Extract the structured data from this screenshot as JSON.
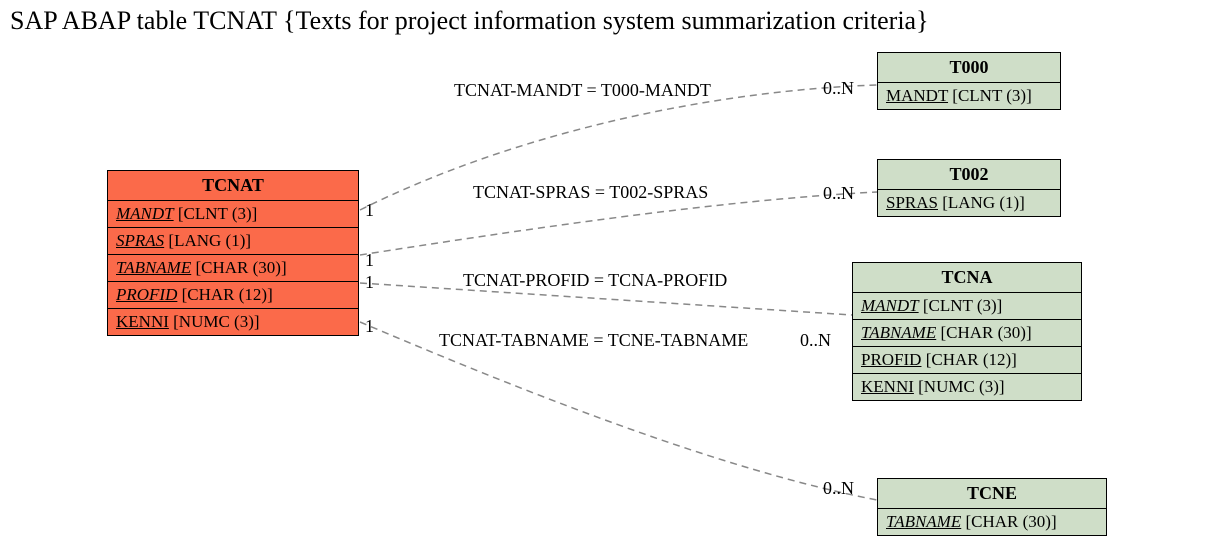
{
  "title": "SAP ABAP table TCNAT {Texts for project information system summarization criteria}",
  "main": {
    "name": "TCNAT",
    "fields": [
      {
        "name": "MANDT",
        "type": "[CLNT (3)]",
        "key": true
      },
      {
        "name": "SPRAS",
        "type": "[LANG (1)]",
        "key": true
      },
      {
        "name": "TABNAME",
        "type": "[CHAR (30)]",
        "key": true
      },
      {
        "name": "PROFID",
        "type": "[CHAR (12)]",
        "key": true
      },
      {
        "name": "KENNI",
        "type": "[NUMC (3)]",
        "key": false
      }
    ]
  },
  "targets": [
    {
      "name": "T000",
      "fields": [
        {
          "name": "MANDT",
          "type": "[CLNT (3)]",
          "key": false,
          "ul": true
        }
      ]
    },
    {
      "name": "T002",
      "fields": [
        {
          "name": "SPRAS",
          "type": "[LANG (1)]",
          "key": false,
          "ul": true
        }
      ]
    },
    {
      "name": "TCNA",
      "fields": [
        {
          "name": "MANDT",
          "type": "[CLNT (3)]",
          "key": true,
          "ul": true
        },
        {
          "name": "TABNAME",
          "type": "[CHAR (30)]",
          "key": true,
          "ul": true
        },
        {
          "name": "PROFID",
          "type": "[CHAR (12)]",
          "key": false,
          "ul": true
        },
        {
          "name": "KENNI",
          "type": "[NUMC (3)]",
          "key": false,
          "ul": true
        }
      ]
    },
    {
      "name": "TCNE",
      "fields": [
        {
          "name": "TABNAME",
          "type": "[CHAR (30)]",
          "key": true,
          "ul": true
        }
      ]
    }
  ],
  "rels": [
    {
      "label": "TCNAT-MANDT = T000-MANDT",
      "srcCard": "1",
      "dstCard": "0..N"
    },
    {
      "label": "TCNAT-SPRAS = T002-SPRAS",
      "srcCard": "1",
      "dstCard": "0..N"
    },
    {
      "label": "TCNAT-PROFID = TCNA-PROFID",
      "srcCard": "1",
      "dstCard": "0..N"
    },
    {
      "label": "TCNAT-TABNAME = TCNE-TABNAME",
      "srcCard": "1",
      "dstCard": "0..N"
    }
  ]
}
